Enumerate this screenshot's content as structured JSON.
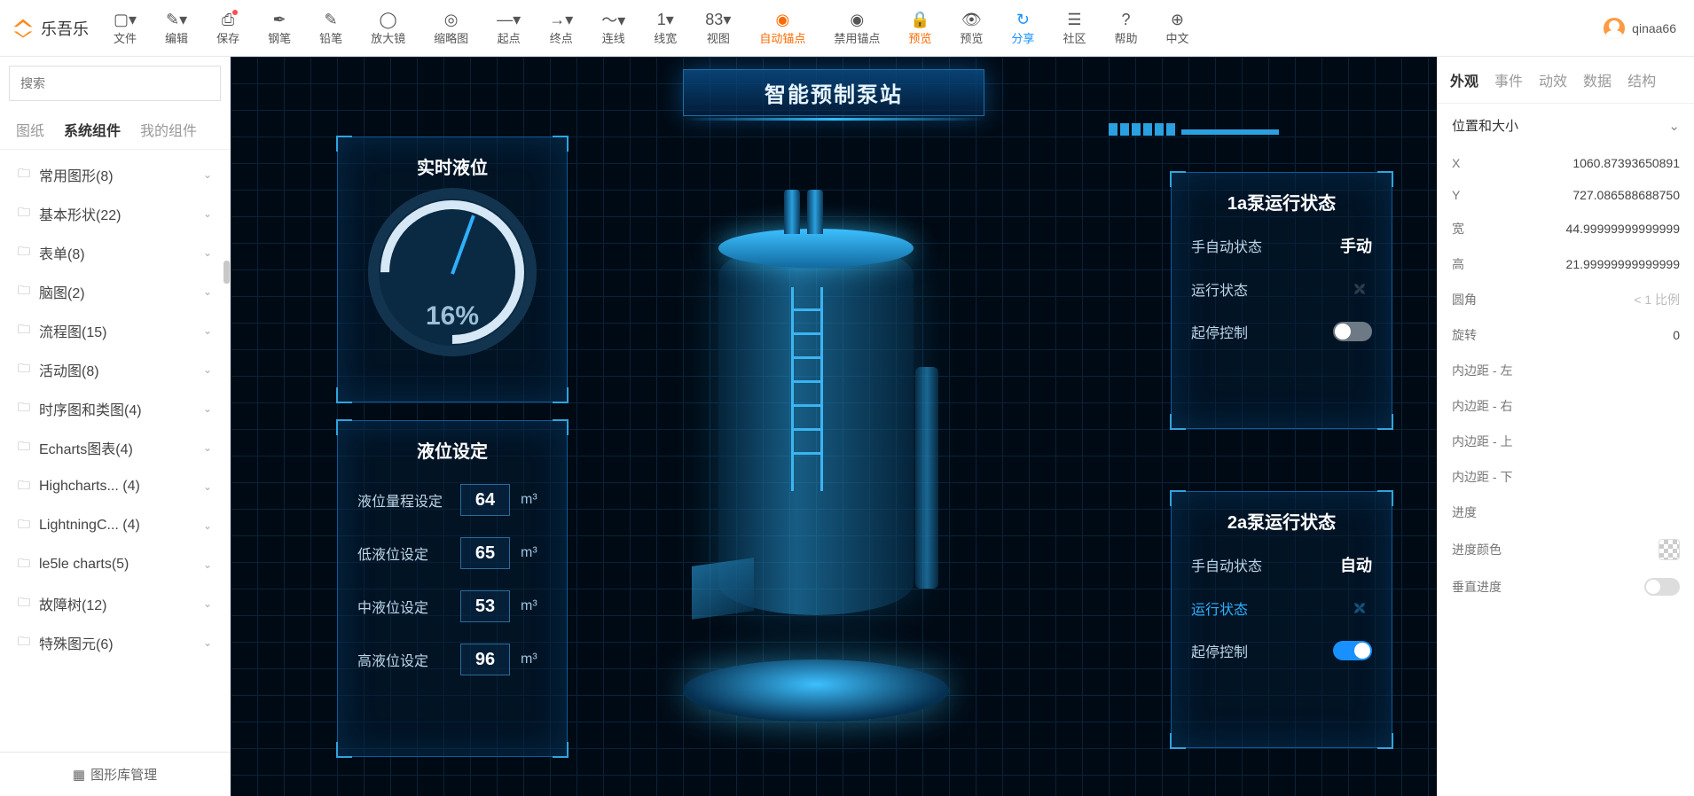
{
  "app": {
    "name": "乐吾乐",
    "user": "qinaa66"
  },
  "menu": [
    {
      "label": "文件",
      "icon": "▢▾"
    },
    {
      "label": "编辑",
      "icon": "✎▾"
    },
    {
      "label": "保存",
      "icon": "⎙",
      "dot": true
    },
    {
      "label": "钢笔",
      "icon": "✒"
    },
    {
      "label": "铅笔",
      "icon": "✎"
    },
    {
      "label": "放大镜",
      "icon": "◯"
    },
    {
      "label": "缩略图",
      "icon": "◎"
    },
    {
      "label": "起点",
      "icon": "—▾"
    },
    {
      "label": "终点",
      "icon": "→▾"
    },
    {
      "label": "连线",
      "icon": "〜▾"
    },
    {
      "label": "线宽",
      "icon": "1▾"
    },
    {
      "label": "视图",
      "icon": "83▾"
    },
    {
      "label": "自动锚点",
      "icon": "◉",
      "cls": "orange"
    },
    {
      "label": "禁用锚点",
      "icon": "◉"
    },
    {
      "label": "预览",
      "icon": "🔒",
      "cls": "orange"
    },
    {
      "label": "预览",
      "icon": "👁"
    },
    {
      "label": "分享",
      "icon": "↻",
      "cls": "blue"
    },
    {
      "label": "社区",
      "icon": "☰"
    },
    {
      "label": "帮助",
      "icon": "?"
    },
    {
      "label": "中文",
      "icon": "⊕"
    }
  ],
  "search": {
    "placeholder": "搜索"
  },
  "leftTabs": [
    "图纸",
    "系统组件",
    "我的组件"
  ],
  "leftActiveTab": 1,
  "tree": [
    {
      "label": "常用图形(8)"
    },
    {
      "label": "基本形状(22)"
    },
    {
      "label": "表单(8)"
    },
    {
      "label": "脑图(2)"
    },
    {
      "label": "流程图(15)"
    },
    {
      "label": "活动图(8)"
    },
    {
      "label": "时序图和类图(4)"
    },
    {
      "label": "Echarts图表(4)"
    },
    {
      "label": "Highcharts... (4)"
    },
    {
      "label": "LightningC... (4)"
    },
    {
      "label": "le5le charts(5)"
    },
    {
      "label": "故障树(12)"
    },
    {
      "label": "特殊图元(6)"
    }
  ],
  "libManage": "图形库管理",
  "canvas": {
    "title": "智能预制泵站",
    "liquidLevel": {
      "title": "实时液位",
      "value": "16%"
    },
    "settings": {
      "title": "液位设定",
      "rows": [
        {
          "label": "液位量程设定",
          "value": "64",
          "unit": "m³"
        },
        {
          "label": "低液位设定",
          "value": "65",
          "unit": "m³"
        },
        {
          "label": "中液位设定",
          "value": "53",
          "unit": "m³"
        },
        {
          "label": "高液位设定",
          "value": "96",
          "unit": "m³"
        }
      ]
    },
    "pump1": {
      "title": "1a泵运行状态",
      "rows": [
        {
          "label": "手自动状态",
          "value": "手动"
        },
        {
          "label": "运行状态",
          "kind": "fan"
        },
        {
          "label": "起停控制",
          "kind": "toggle",
          "on": false
        }
      ]
    },
    "pump2": {
      "title": "2a泵运行状态",
      "rows": [
        {
          "label": "手自动状态",
          "value": "自动"
        },
        {
          "label": "运行状态",
          "kind": "fan",
          "blue": true
        },
        {
          "label": "起停控制",
          "kind": "toggle",
          "on": true
        }
      ]
    }
  },
  "rightTabs": [
    "外观",
    "事件",
    "动效",
    "数据",
    "结构"
  ],
  "rightActiveTab": 0,
  "propsSection": "位置和大小",
  "props": [
    {
      "label": "X",
      "value": "1060.87393650891"
    },
    {
      "label": "Y",
      "value": "727.086588688750"
    },
    {
      "label": "宽",
      "value": "44.99999999999999"
    },
    {
      "label": "高",
      "value": "21.99999999999999"
    },
    {
      "label": "圆角",
      "value": "< 1 比例",
      "ph": true
    },
    {
      "label": "旋转",
      "value": "0"
    },
    {
      "label": "内边距 - 左",
      "value": ""
    },
    {
      "label": "内边距 - 右",
      "value": ""
    },
    {
      "label": "内边距 - 上",
      "value": ""
    },
    {
      "label": "内边距 - 下",
      "value": ""
    },
    {
      "label": "进度",
      "value": ""
    },
    {
      "label": "进度颜色",
      "kind": "color"
    },
    {
      "label": "垂直进度",
      "kind": "toggle"
    }
  ]
}
